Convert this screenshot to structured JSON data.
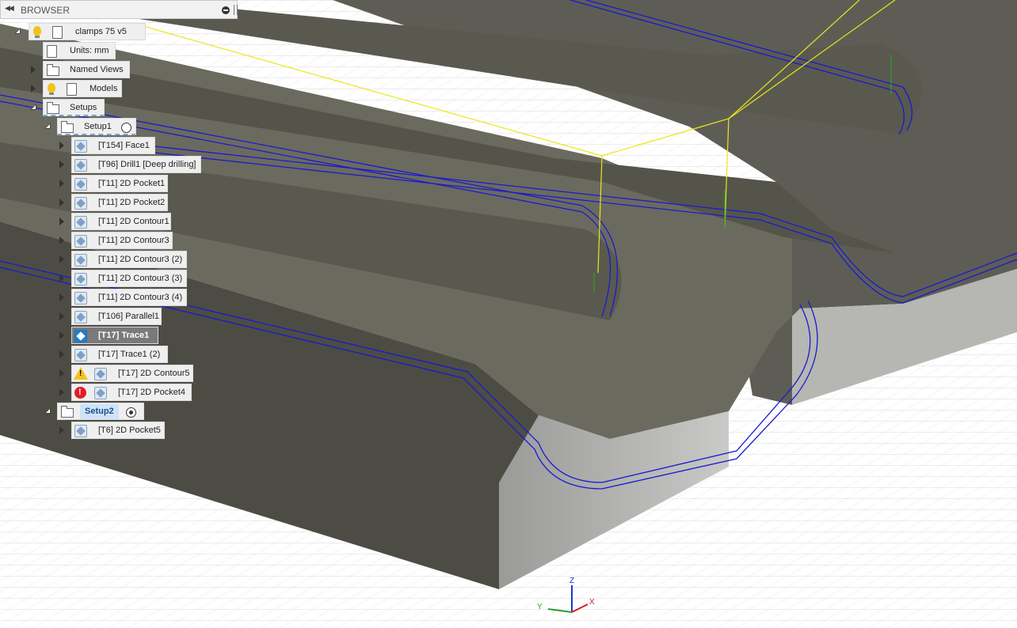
{
  "browser": {
    "title": "BROWSER",
    "root": {
      "label": "clamps 75 v5"
    },
    "units": {
      "label": "Units: mm"
    },
    "named_views": {
      "label": "Named Views"
    },
    "models": {
      "label": "Models"
    },
    "setups": {
      "label": "Setups"
    },
    "setup1": {
      "label": "Setup1",
      "operations": [
        {
          "label": "[T154] Face1"
        },
        {
          "label": "[T96] Drill1 [Deep drilling]"
        },
        {
          "label": "[T11] 2D Pocket1"
        },
        {
          "label": "[T11] 2D Pocket2"
        },
        {
          "label": "[T11] 2D Contour1"
        },
        {
          "label": "[T11] 2D Contour3"
        },
        {
          "label": "[T11] 2D Contour3 (2)"
        },
        {
          "label": "[T11] 2D Contour3 (3)"
        },
        {
          "label": "[T11] 2D Contour3 (4)"
        },
        {
          "label": "[T106] Parallel1"
        },
        {
          "label": "[T17] Trace1",
          "selected": true
        },
        {
          "label": "[T17] Trace1 (2)"
        },
        {
          "label": "[T17] 2D Contour5",
          "status": "warning"
        },
        {
          "label": "[T17] 2D Pocket4",
          "status": "error"
        }
      ]
    },
    "setup2": {
      "label": "Setup2",
      "active": true,
      "operations": [
        {
          "label": "[T6] 2D Pocket5"
        }
      ]
    }
  },
  "triad": {
    "z": "Z",
    "x": "X",
    "y": "Y"
  },
  "colors": {
    "toolpath": "#1a1ad0",
    "rapid": "#e8e81a",
    "plunge": "#2aa02a",
    "part_top": "#6b6a5f",
    "part_side": "#48473f",
    "selection": "#1f7fd0"
  }
}
